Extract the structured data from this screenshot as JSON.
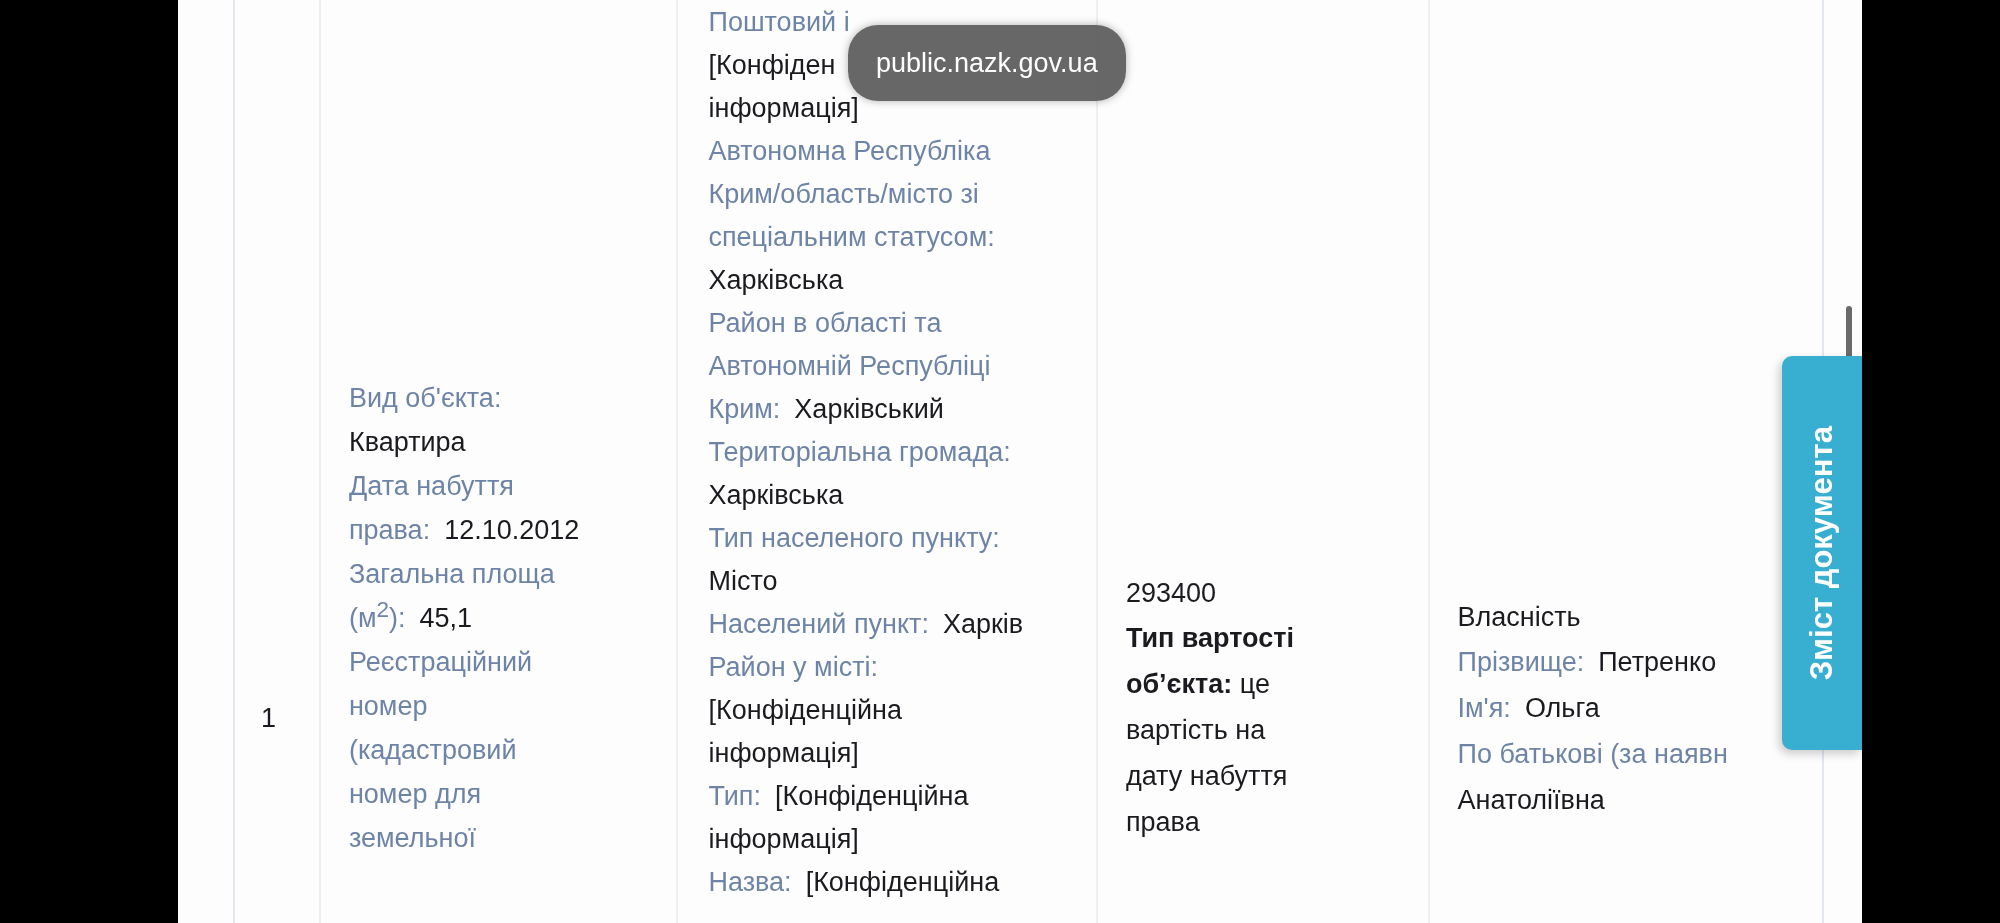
{
  "url_pill": "public.nazk.gov.ua",
  "side_tab": "Зміст документа",
  "table": {
    "rows": [
      {
        "number": "1",
        "object_fields": [
          {
            "kind": "block",
            "label": "Вид об'єкта:",
            "value": "Квартира"
          },
          {
            "kind": "inline",
            "label": "Дата набуття права:",
            "value": "12.10.2012"
          },
          {
            "kind": "inline",
            "label": "Загальна площа (м$^{2}$):",
            "value": "45,1"
          },
          {
            "kind": "block",
            "label": "Реєстраційний номер (кадастровий номер для земельної"
          }
        ],
        "address_fields": [
          {
            "kind": "block",
            "label": "Поштовий і"
          },
          {
            "kind": "block",
            "value": "[Конфіден"
          },
          {
            "kind": "block",
            "value": "інформація]"
          },
          {
            "kind": "block",
            "label": "Автономна Республіка Крим/область/місто зі спеціальним статусом:",
            "value": "Харківська"
          },
          {
            "kind": "inline",
            "label": "Район в області та Автономній Республіці Крим:",
            "value": "Харківський"
          },
          {
            "kind": "block",
            "label": "Територіальна громада:",
            "value": "Харківська"
          },
          {
            "kind": "block",
            "label": "Тип населеного пункту:",
            "value": "Місто"
          },
          {
            "kind": "inline",
            "label": "Населений пункт:",
            "value": "Харків"
          },
          {
            "kind": "block",
            "label": "Район у місті:",
            "value": "[Конфіденційна інформація]"
          },
          {
            "kind": "inline",
            "label": "Тип:",
            "value": "[Конфіденційна інформація]"
          },
          {
            "kind": "inline",
            "label": "Назва:",
            "value": "[Конфіденційна"
          }
        ],
        "value_amount": "293400",
        "value_note": "**Тип вартості об’єкта:** це вартість на дату набуття права",
        "right_type": "Власність",
        "owner_fields": [
          {
            "kind": "inline",
            "label": "Прізвище:",
            "value": "Петренко"
          },
          {
            "kind": "inline",
            "label": "Ім'я:",
            "value": "Ольга"
          },
          {
            "kind": "block",
            "label": "По батькові (за наявн",
            "value": "Анатоліївна"
          }
        ]
      }
    ]
  }
}
